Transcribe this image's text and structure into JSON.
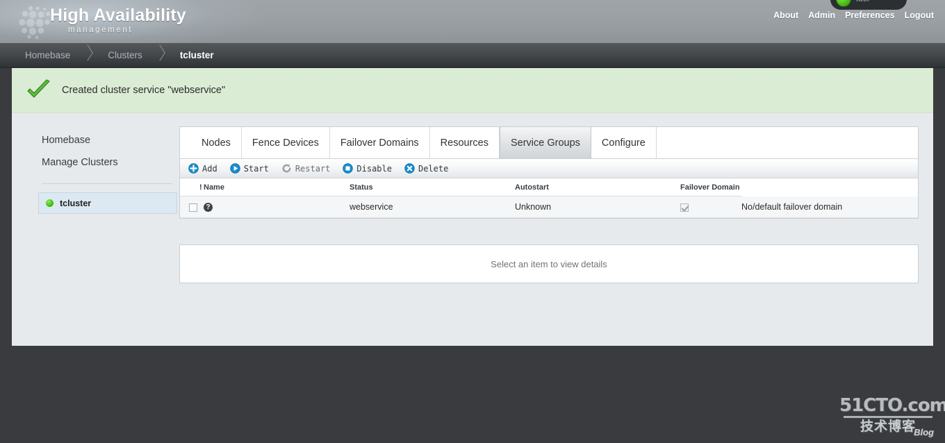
{
  "header": {
    "brand_main": "High Availability",
    "brand_sub": "management",
    "logo_icon": "hex-dots-logo",
    "status_pill": {
      "indicator": "green-status-dot",
      "label": "luci"
    },
    "links": [
      {
        "label": "About"
      },
      {
        "label": "Admin"
      },
      {
        "label": "Preferences"
      },
      {
        "label": "Logout"
      }
    ]
  },
  "breadcrumb": [
    {
      "label": "Homebase",
      "current": false
    },
    {
      "label": "Clusters",
      "current": false
    },
    {
      "label": "tcluster",
      "current": true
    }
  ],
  "notice": {
    "icon": "green-check-icon",
    "message": "Created cluster service \"webservice\""
  },
  "sidebar": {
    "links": [
      {
        "label": "Homebase"
      },
      {
        "label": "Manage Clusters"
      }
    ],
    "cluster": {
      "label": "tcluster",
      "status_icon": "green-status-dot"
    }
  },
  "tabs": [
    {
      "label": "Nodes",
      "active": false
    },
    {
      "label": "Fence Devices",
      "active": false
    },
    {
      "label": "Failover Domains",
      "active": false
    },
    {
      "label": "Resources",
      "active": false
    },
    {
      "label": "Service Groups",
      "active": true
    },
    {
      "label": "Configure",
      "active": false
    }
  ],
  "toolbar": [
    {
      "label": "Add",
      "icon": "plus-circle-icon",
      "color": "#1a8fd0",
      "disabled": false
    },
    {
      "label": "Start",
      "icon": "play-circle-icon",
      "color": "#1a8fd0",
      "disabled": false
    },
    {
      "label": "Restart",
      "icon": "refresh-circle-icon",
      "color": "#9aa0a6",
      "disabled": true
    },
    {
      "label": "Disable",
      "icon": "stop-circle-icon",
      "color": "#1a8fd0",
      "disabled": false
    },
    {
      "label": "Delete",
      "icon": "x-circle-icon",
      "color": "#1a8fd0",
      "disabled": false
    }
  ],
  "table": {
    "columns": [
      "!",
      "Name",
      "Status",
      "Autostart",
      "Failover Domain"
    ],
    "rows": [
      {
        "selected": false,
        "flag_icon": "question-mark-icon",
        "name": "webservice",
        "status": "Unknown",
        "autostart": true,
        "failover_domain": "No/default failover domain"
      }
    ]
  },
  "details": {
    "placeholder": "Select an item to view details"
  },
  "watermark": {
    "top": "51CTO.com",
    "bottom": "技术博客",
    "tag": "Blog"
  }
}
